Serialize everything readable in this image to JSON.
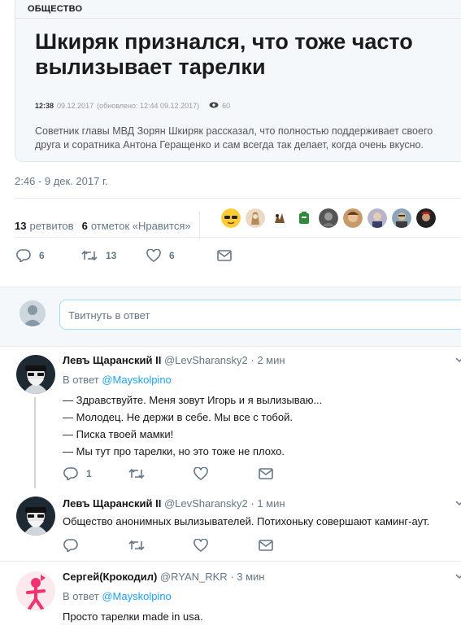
{
  "article": {
    "section": "ОБЩЕСТВО",
    "headline_line1": "Шкиряк признался, что тоже часто",
    "headline_line2": "вылизывает тарелки",
    "time": "12:38",
    "date": "09.12.2017",
    "updated": "(обновлено: 12:44 09.12.2017)",
    "views": "60",
    "lead_line1": "Советник главы МВД Зорян Шкиряк рассказал, что полностью поддерживает своего",
    "lead_line2": "друга и соратника Антона Геращенко и сам всегда так делает, когда очень вкусно."
  },
  "tweet": {
    "timestamp": "2:46 - 9 дек. 2017 г.",
    "retweets_count": "13",
    "retweets_label": "ретвитов",
    "likes_count": "6",
    "likes_label": "отметок «Нравится»",
    "actions": {
      "replies": "6",
      "retweets": "13",
      "likes": "6"
    }
  },
  "composer": {
    "placeholder": "Твитнуть в ответ"
  },
  "replies": [
    {
      "name": "Левъ Щаранский II",
      "handle": "@LevSharansky2",
      "time": "· 2 мин",
      "in_reply_prefix": "В ответ",
      "in_reply_to": "@Mayskolpino",
      "lines": [
        "— Здравствуйте. Меня зовут Игорь и я вылизываю...",
        "— Молодец. Не держи в себе. Мы все с тобой.",
        "— Писка твоей мамки!",
        "— Мы тут про тарелки, но это тоже не плохо."
      ],
      "reply_count": "1"
    },
    {
      "name": "Левъ Щаранский II",
      "handle": "@LevSharansky2",
      "time": "· 1 мин",
      "text": "Общество анонимных вылизывателей. Потихоньку совершают каминг-аут."
    },
    {
      "name": "Сергей(Крокодил)",
      "handle": "@RYAN_RKR",
      "time": "· 3 мин",
      "in_reply_prefix": "В ответ",
      "in_reply_to": "@Mayskolpino",
      "text": "Просто тарелки made in usa."
    }
  ],
  "colors": {
    "accent": "#1da1f2",
    "muted": "#657786",
    "text": "#14171a"
  },
  "icons": [
    "eye-icon",
    "reply-icon",
    "retweet-icon",
    "like-icon",
    "dm-icon",
    "chevron-down-icon"
  ]
}
